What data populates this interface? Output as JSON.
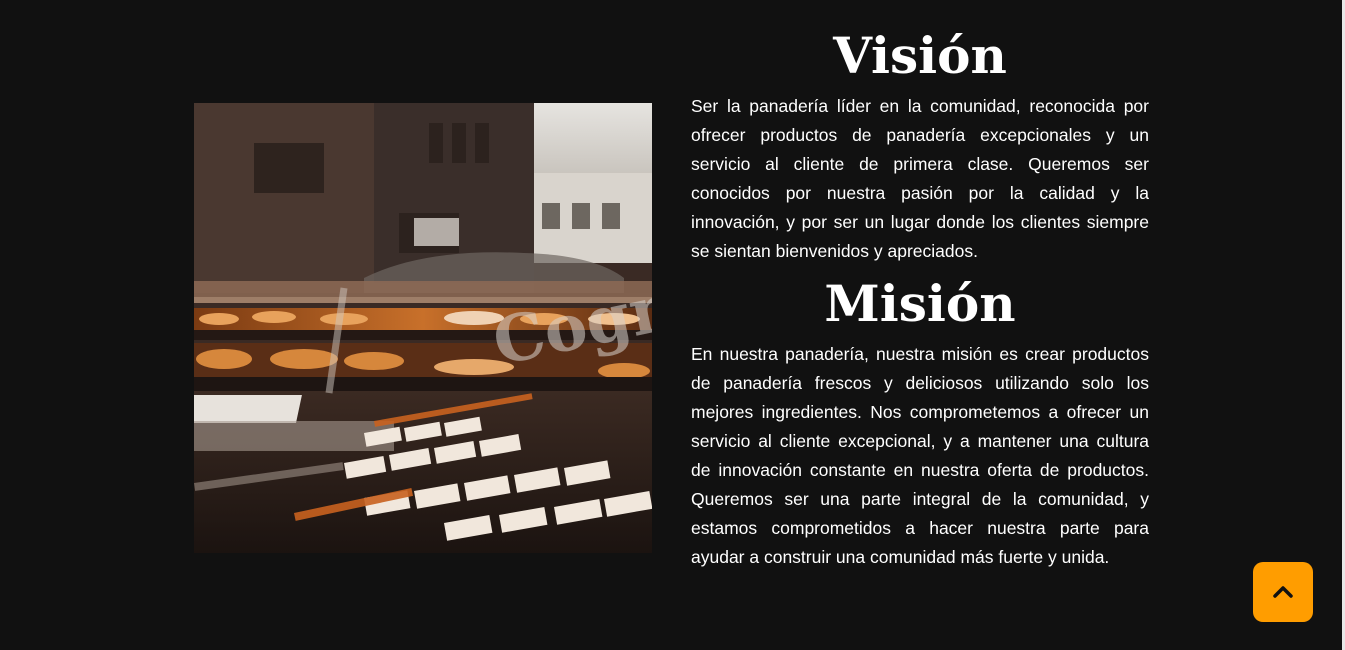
{
  "vision": {
    "heading": "Visión",
    "text": "Ser la panadería líder en la comunidad, reconocida por ofrecer productos de panadería excepcionales y un servicio al cliente de primera clase. Queremos ser conocidos por nuestra pasión por la calidad y la innovación, y por ser un lugar donde los clientes siempre se sientan bienvenidos y apreciados."
  },
  "mission": {
    "heading": "Misión",
    "text": "En nuestra panadería, nuestra misión es crear productos de panadería frescos y deliciosos utilizando solo los mejores ingredientes. Nos comprometemos a ofrecer un servicio al cliente excepcional, y a mantener una cultura de innovación constante en nuestra oferta de productos. Queremos ser una parte integral de la comunidad, y estamos comprometidos a hacer nuestra parte para ayudar a construir una comunidad más fuerte y unida."
  },
  "photo": {
    "window_lettering": "Cogn"
  },
  "scroll_top": {
    "icon": "chevron-up-icon",
    "color": "#ff9d00"
  },
  "colors": {
    "background": "#111111",
    "text": "#ffffff",
    "accent": "#ff9d00"
  }
}
